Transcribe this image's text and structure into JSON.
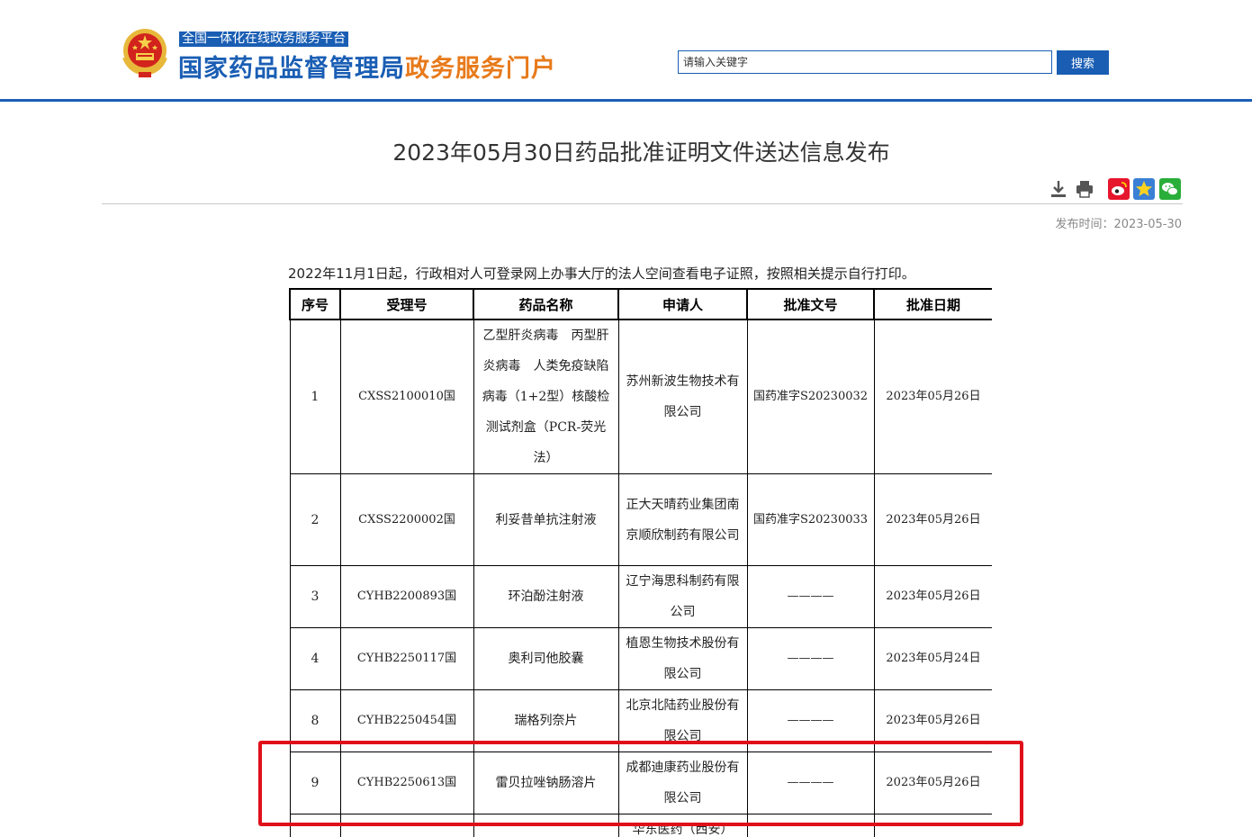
{
  "header": {
    "portal_subtitle": "全国一体化在线政务服务平台",
    "portal_title_main": "国家药品监督管理局",
    "portal_title_accent": "政务服务门户",
    "search_placeholder": "请输入关键字",
    "search_button_label": "搜索",
    "icons": {
      "emblem": "national-emblem-icon"
    }
  },
  "article": {
    "title": "2023年05月30日药品批准证明文件送达信息发布",
    "publish_time": "发布时间：2023-05-30",
    "intro": "2022年11月1日起，行政相对人可登录网上办事大厅的法人空间查看电子证照，按照相关提示自行打印。",
    "toolbar_icons": [
      "download-icon",
      "print-icon",
      "weibo-share-icon",
      "favorite-star-icon",
      "wechat-share-icon"
    ]
  },
  "table": {
    "headers": [
      "序号",
      "受理号",
      "药品名称",
      "申请人",
      "批准文号",
      "批准日期"
    ],
    "rows": [
      {
        "no": "1",
        "accept": "CXSS2100010国",
        "drug": "乙型肝炎病毒　丙型肝炎病毒　人类免疫缺陷病毒（1+2型）核酸检测试剂盒（PCR-荧光法）",
        "applicant": "苏州新波生物技术有限公司",
        "approval_no": "国药准字S20230032",
        "date": "2023年05月26日"
      },
      {
        "no": "2",
        "accept": "CXSS2200002国",
        "drug": "利妥昔单抗注射液",
        "applicant": "正大天晴药业集团南京顺欣制药有限公司",
        "approval_no": "国药准字S20230033",
        "date": "2023年05月26日"
      },
      {
        "no": "3",
        "accept": "CYHB2200893国",
        "drug": "环泊酚注射液",
        "applicant": "辽宁海思科制药有限公司",
        "approval_no": "————",
        "date": "2023年05月26日"
      },
      {
        "no": "4",
        "accept": "CYHB2250117国",
        "drug": "奥利司他胶囊",
        "applicant": "植恩生物技术股份有限公司",
        "approval_no": "————",
        "date": "2023年05月24日"
      },
      {
        "no": "8",
        "accept": "CYHB2250454国",
        "drug": "瑞格列奈片",
        "applicant": "北京北陆药业股份有限公司",
        "approval_no": "————",
        "date": "2023年05月26日"
      },
      {
        "no": "9",
        "accept": "CYHB2250613国",
        "drug": "雷贝拉唑钠肠溶片",
        "applicant": "成都迪康药业股份有限公司",
        "approval_no": "————",
        "date": "2023年05月26日"
      },
      {
        "no": "",
        "accept": "",
        "drug": "",
        "applicant": "华东医药（西安）",
        "approval_no": "",
        "date": ""
      }
    ]
  },
  "colors": {
    "brand_blue": "#1a5eb4",
    "brand_orange": "#e87a1a",
    "highlight_red": "#e0101a"
  }
}
